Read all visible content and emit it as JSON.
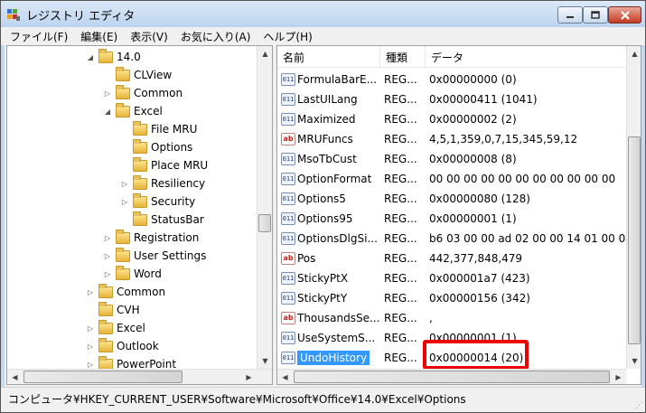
{
  "window": {
    "title": "レジストリ エディタ"
  },
  "menu": [
    "ファイル(F)",
    "編集(E)",
    "表示(V)",
    "お気に入り(A)",
    "ヘルプ(H)"
  ],
  "tree": [
    {
      "label": "14.0",
      "expander": "◢",
      "indent": 5
    },
    {
      "label": "CLView",
      "expander": "",
      "indent": 6
    },
    {
      "label": "Common",
      "expander": "▷",
      "indent": 6
    },
    {
      "label": "Excel",
      "expander": "◢",
      "indent": 6
    },
    {
      "label": "File MRU",
      "expander": "",
      "indent": 7
    },
    {
      "label": "Options",
      "expander": "",
      "indent": 7
    },
    {
      "label": "Place MRU",
      "expander": "",
      "indent": 7
    },
    {
      "label": "Resiliency",
      "expander": "▷",
      "indent": 7
    },
    {
      "label": "Security",
      "expander": "▷",
      "indent": 7
    },
    {
      "label": "StatusBar",
      "expander": "",
      "indent": 7
    },
    {
      "label": "Registration",
      "expander": "▷",
      "indent": 6
    },
    {
      "label": "User Settings",
      "expander": "▷",
      "indent": 6
    },
    {
      "label": "Word",
      "expander": "▷",
      "indent": 6
    },
    {
      "label": "Common",
      "expander": "▷",
      "indent": 5
    },
    {
      "label": "CVH",
      "expander": "",
      "indent": 5
    },
    {
      "label": "Excel",
      "expander": "▷",
      "indent": 5
    },
    {
      "label": "Outlook",
      "expander": "▷",
      "indent": 5
    },
    {
      "label": "PowerPoint",
      "expander": "▷",
      "indent": 5
    }
  ],
  "list": {
    "headers": {
      "name": "名前",
      "type": "種類",
      "data": "データ"
    },
    "rows": [
      {
        "icon": "binary-value-icon",
        "name": "FormulaBarE...",
        "type": "REG...",
        "data": "0x00000000 (0)"
      },
      {
        "icon": "binary-value-icon",
        "name": "LastUILang",
        "type": "REG...",
        "data": "0x00000411 (1041)"
      },
      {
        "icon": "binary-value-icon",
        "name": "Maximized",
        "type": "REG...",
        "data": "0x00000002 (2)"
      },
      {
        "icon": "string-value-icon",
        "name": "MRUFuncs",
        "type": "REG...",
        "data": "4,5,1,359,0,7,15,345,59,12"
      },
      {
        "icon": "binary-value-icon",
        "name": "MsoTbCust",
        "type": "REG...",
        "data": "0x00000008 (8)"
      },
      {
        "icon": "binary-value-icon",
        "name": "OptionFormat",
        "type": "REG...",
        "data": "00 00 00 00 00 00 00 00 00 00 00"
      },
      {
        "icon": "binary-value-icon",
        "name": "Options5",
        "type": "REG...",
        "data": "0x00000080 (128)"
      },
      {
        "icon": "binary-value-icon",
        "name": "Options95",
        "type": "REG...",
        "data": "0x00000001 (1)"
      },
      {
        "icon": "binary-value-icon",
        "name": "OptionsDlgSi...",
        "type": "REG...",
        "data": "b6 03 00 00 ad 02 00 00 14 01 00 00"
      },
      {
        "icon": "string-value-icon",
        "name": "Pos",
        "type": "REG...",
        "data": "442,377,848,479"
      },
      {
        "icon": "binary-value-icon",
        "name": "StickyPtX",
        "type": "REG...",
        "data": "0x000001a7 (423)"
      },
      {
        "icon": "binary-value-icon",
        "name": "StickyPtY",
        "type": "REG...",
        "data": "0x00000156 (342)"
      },
      {
        "icon": "string-value-icon",
        "name": "ThousandsSe...",
        "type": "REG...",
        "data": ","
      },
      {
        "icon": "binary-value-icon",
        "name": "UseSystemS...",
        "type": "REG...",
        "data": "0x00000001 (1)"
      },
      {
        "icon": "binary-value-icon",
        "name": "UndoHistory",
        "type": "REG...",
        "data": "0x00000014 (20)",
        "selected": true
      }
    ]
  },
  "statusbar": {
    "path": "コンピュータ¥HKEY_CURRENT_USER¥Software¥Microsoft¥Office¥14.0¥Excel¥Options"
  },
  "colors": {
    "selection": "#3399ff",
    "highlight_box": "#ee0000"
  }
}
